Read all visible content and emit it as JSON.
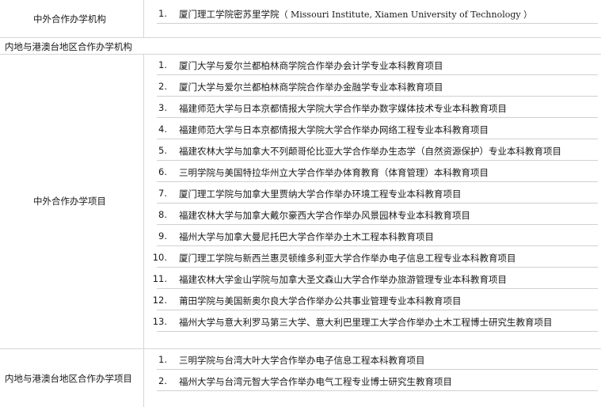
{
  "sections": [
    {
      "label": "中外合作办学机构",
      "items": [
        {
          "num": "1.",
          "text": "厦门理工学院密苏里学院",
          "en": "（ Missouri Institute, Xiamen University of Technology ）"
        }
      ]
    },
    {
      "label": "内地与港澳台地区合作办学机构",
      "items": []
    },
    {
      "label": "中外合作办学项目",
      "items": [
        {
          "num": "1.",
          "text": "厦门大学与爱尔兰都柏林商学院合作举办会计学专业本科教育项目"
        },
        {
          "num": "2.",
          "text": "厦门大学与爱尔兰都柏林商学院合作举办金融学专业本科教育项目"
        },
        {
          "num": "3.",
          "text": "福建师范大学与日本京都情报大学院大学合作举办数字媒体技术专业本科教育项目"
        },
        {
          "num": "4.",
          "text": "福建师范大学与日本京都情报大学院大学合作举办网络工程专业本科教育项目"
        },
        {
          "num": "5.",
          "text": "福建农林大学与加拿大不列颠哥伦比亚大学合作举办生态学（自然资源保护）专业本科教育项目"
        },
        {
          "num": "6.",
          "text": "三明学院与美国特拉华州立大学合作举办体育教育（体育管理）本科教育项目"
        },
        {
          "num": "7.",
          "text": "厦门理工学院与加拿大里贾纳大学合作举办环境工程专业本科教育项目"
        },
        {
          "num": "8.",
          "text": "福建农林大学与加拿大戴尔豪西大学合作举办风景园林专业本科教育项目"
        },
        {
          "num": "9.",
          "text": "福州大学与加拿大曼尼托巴大学合作举办土木工程本科教育项目"
        },
        {
          "num": "10.",
          "text": "厦门理工学院与新西兰惠灵顿维多利亚大学合作举办电子信息工程专业本科教育项目"
        },
        {
          "num": "11.",
          "text": "福建农林大学金山学院与加拿大圣文森山大学合作举办旅游管理专业本科教育项目"
        },
        {
          "num": "12.",
          "text": "莆田学院与美国新奥尔良大学合作举办公共事业管理专业本科教育项目"
        },
        {
          "num": "13.",
          "text": "福州大学与意大利罗马第三大学、意大利巴里理工大学合作举办土木工程博士研究生教育项目"
        }
      ]
    },
    {
      "label": "内地与港澳台地区合作办学项目",
      "items": [
        {
          "num": "1.",
          "text": "三明学院与台湾大叶大学合作举办电子信息工程本科教育项目"
        },
        {
          "num": "2.",
          "text": "福州大学与台湾元智大学合作举办电气工程专业博士研究生教育项目"
        }
      ]
    }
  ]
}
